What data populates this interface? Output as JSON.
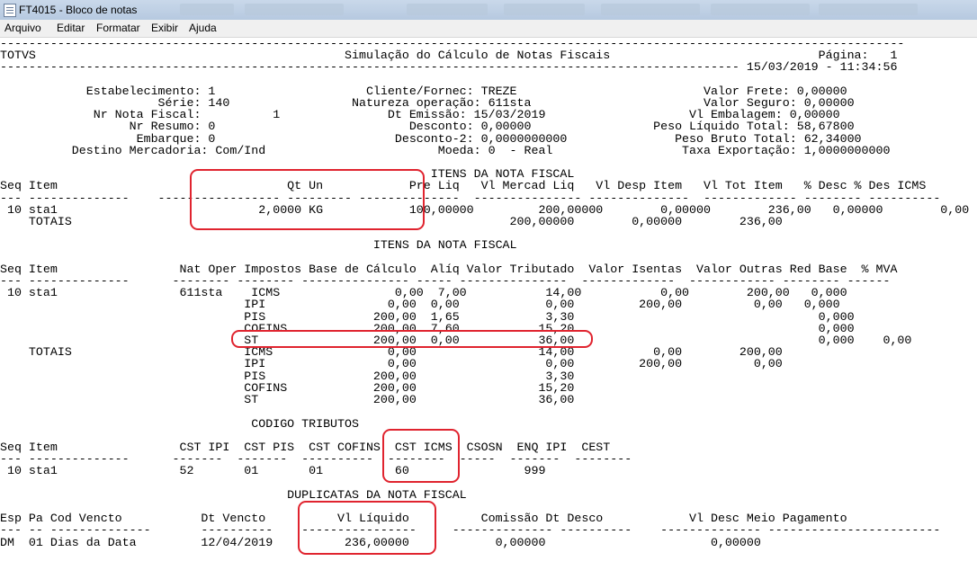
{
  "window": {
    "title": "FT4015 - Bloco de notas"
  },
  "menu": {
    "arquivo": "Arquivo",
    "editar": "Editar",
    "formatar": "Formatar",
    "exibir": "Exibir",
    "ajuda": "Ajuda"
  },
  "doc": {
    "lines": [
      "------------------------------------------------------------------------------------------------------------------------------",
      "TOTVS                                           Simulação do Cálculo de Notas Fiscais                             Página:   1",
      "------------------------------------------------------------------------------------------------------- 15/03/2019 - 11:34:56",
      "",
      "            Estabelecimento: 1                     Cliente/Fornec: TREZE                          Valor Frete: 0,00000",
      "                      Série: 140                 Natureza operação: 611sta                        Valor Seguro: 0,00000",
      "             Nr Nota Fiscal:          1               Dt Emissão: 15/03/2019                    Vl Embalagem: 0,00000",
      "                  Nr Resumo: 0                           Desconto: 0,00000                 Peso Líquido Total: 58,67800",
      "                   Embarque: 0                         Desconto-2: 0,0000000000               Peso Bruto Total: 62,34000",
      "          Destino Mercadoria: Com/Ind                        Moeda: 0  - Real                  Taxa Exportação: 1,0000000000",
      "",
      "                                                            ITENS DA NOTA FISCAL",
      "Seq Item                                Qt Un            Pre Liq   Vl Mercad Liq   Vl Desp Item   Vl Tot Item   % Desc % Des ICMS",
      "--- --------------    ----------------- --------- --------------  --------------- --------------  ------------- -------- ----------",
      " 10 sta1                            2,0000 KG            100,00000         200,00000        0,00000        236,00   0,00000        0,00",
      "    TOTAIS                                                             200,00000        0,00000        236,00",
      "",
      "                                                    ITENS DA NOTA FISCAL",
      "",
      "Seq Item                 Nat Oper Impostos Base de Cálculo  Alíq Valor Tributado  Valor Isentas  Valor Outras Red Base  % MVA",
      "--- --------------      -------- -------- --------------- ----- ---------------  -------------  ------------ -------- ------",
      " 10 sta1                 611sta    ICMS                0,00  7,00           14,00           0,00        200,00   0,000",
      "                                  IPI                 0,00  0,00            0,00         200,00          0,00   0,000",
      "                                  PIS               200,00  1,65            3,30                                  0,000",
      "                                  COFINS            200,00  7,60           15,20                                  0,000",
      "                                  ST                200,00  0,00           36,00                                  0,000    0,00",
      "    TOTAIS                        ICMS                0,00                 14,00           0,00        200,00",
      "                                  IPI                 0,00                  0,00         200,00          0,00",
      "                                  PIS               200,00                  3,30",
      "                                  COFINS            200,00                 15,20",
      "                                  ST                200,00                 36,00",
      "",
      "                                   CODIGO TRIBUTOS",
      "",
      "Seq Item                 CST IPI  CST PIS  CST COFINS  CST ICMS  CSOSN  ENQ IPI  CEST",
      "--- --------------      -------  -------  ----------  --------  -----  -------  --------",
      " 10 sta1                 52       01       01          60                999",
      "",
      "                                        DUPLICATAS DA NOTA FISCAL",
      "",
      "Esp Pa Cod Vencto           Dt Vencto          Vl Líquido          Comissão Dt Desco            Vl Desc Meio Pagamento",
      "--- -- --------------       ----------    ----------------     -------------- ----------    -------------- ------------------------",
      "DM  01 Dias da Data         12/04/2019          236,00000            0,00000                       0,00000"
    ]
  }
}
